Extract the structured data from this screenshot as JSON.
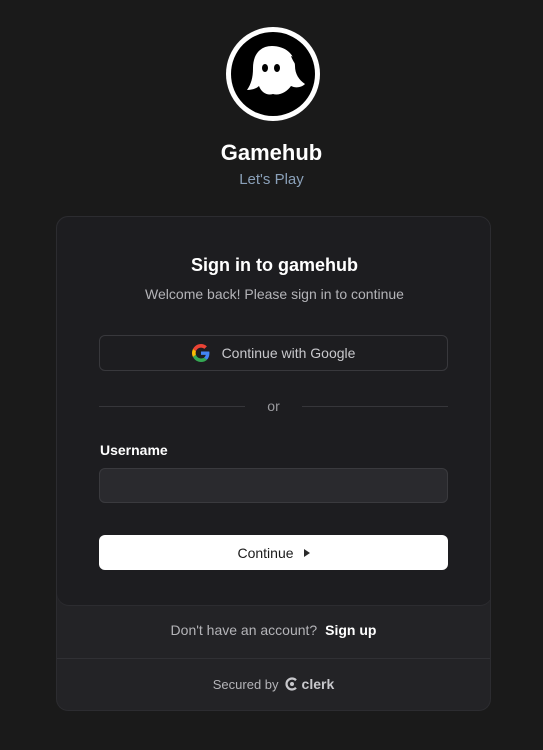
{
  "app": {
    "title": "Gamehub",
    "subtitle": "Let's Play",
    "logo_icon": "ghost-logo-icon"
  },
  "signin": {
    "title": "Sign in to gamehub",
    "subtitle": "Welcome back! Please sign in to continue",
    "google_label": "Continue with Google",
    "divider": "or",
    "username_label": "Username",
    "username_value": "",
    "continue_label": "Continue"
  },
  "footer": {
    "no_account": "Don't have an account?",
    "signup": "Sign up",
    "secured_by": "Secured by",
    "brand": "clerk"
  },
  "colors": {
    "background": "#1a1a1a",
    "card": "#1d1d20",
    "subtitle_accent": "#8aa0b8",
    "primary_button": "#ffffff"
  }
}
